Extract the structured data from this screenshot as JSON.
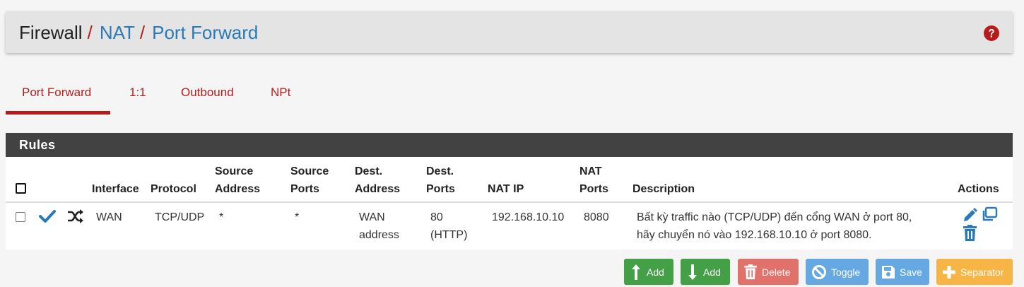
{
  "breadcrumb": {
    "root": "Firewall",
    "sep": "/",
    "level1": "NAT",
    "level2": "Port Forward"
  },
  "help_icon": "question-circle-icon",
  "tabs": [
    "Port Forward",
    "1:1",
    "Outbound",
    "NPt"
  ],
  "active_tab": "Port Forward",
  "panel": {
    "title": "Rules"
  },
  "table": {
    "headers": {
      "interface": "Interface",
      "protocol": "Protocol",
      "source_address": [
        "Source",
        "Address"
      ],
      "source_ports": [
        "Source",
        "Ports"
      ],
      "dest_address": [
        "Dest.",
        "Address"
      ],
      "dest_ports": [
        "Dest.",
        "Ports"
      ],
      "nat_ip": "NAT IP",
      "nat_ports": [
        "NAT",
        "Ports"
      ],
      "description": "Description",
      "actions": "Actions"
    },
    "rows": [
      {
        "enabled_icon": "check-icon",
        "type_icon": "random-icon",
        "interface": "WAN",
        "protocol": "TCP/UDP",
        "source_address": "*",
        "source_ports": "*",
        "dest_address": [
          "WAN",
          "address"
        ],
        "dest_ports": [
          "80",
          "(HTTP)"
        ],
        "nat_ip": "192.168.10.10",
        "nat_ports": "8080",
        "description": [
          "Bất kỳ traffic nào (TCP/UDP) đến cổng WAN ở port 80,",
          "hãy chuyển nó vào 192.168.10.10 ở port 8080."
        ]
      }
    ]
  },
  "buttons": {
    "add_top": "Add",
    "add_bottom": "Add",
    "delete": "Delete",
    "toggle": "Toggle",
    "save": "Save",
    "separator": "Separator"
  },
  "colors": {
    "accent_red": "#b71c1c",
    "link_blue": "#2a7ab8",
    "panel_heading": "#424242",
    "success_green": "#43a047",
    "danger": "#e0716b",
    "info": "#66a8e2",
    "warning": "#f7b545"
  }
}
